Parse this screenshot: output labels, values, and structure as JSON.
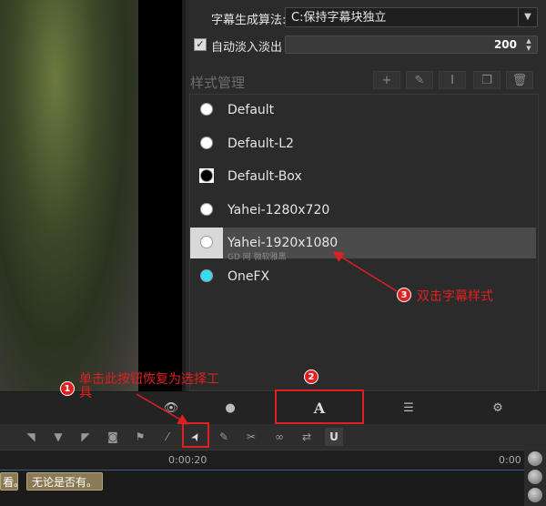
{
  "settings": {
    "algorithm_label": "字幕生成算法:",
    "algorithm_value": "C:保持字幕块独立",
    "fade_label": "自动淡入淡出",
    "fade_checked": true,
    "fade_value": "200"
  },
  "style_manager": {
    "title": "样式管理",
    "buttons": [
      {
        "icon": "plus-icon",
        "glyph": "+"
      },
      {
        "icon": "pencil-icon",
        "glyph": "✎"
      },
      {
        "icon": "text-cursor-icon",
        "glyph": "I"
      },
      {
        "icon": "copy-icon",
        "glyph": "❐"
      },
      {
        "icon": "trash-icon",
        "glyph": "🗑"
      }
    ],
    "items": [
      {
        "label": "Default",
        "dot_color": "#ffffff"
      },
      {
        "label": "Default-L2",
        "dot_color": "#ffffff"
      },
      {
        "label": "Default-Box",
        "dot_color": "#000000"
      },
      {
        "label": "Yahei-1280x720",
        "dot_color": "#ffffff"
      },
      {
        "label": "Yahei-1920x1080",
        "dot_color": "#ffffff",
        "selected": true
      },
      {
        "label": "OneFX",
        "dot_color": "#33ddf5"
      }
    ],
    "watermark": "GD 网 微软雅黑"
  },
  "tabs": [
    {
      "name": "eye-icon",
      "glyph": "👁"
    },
    {
      "name": "chat-bubble-icon",
      "glyph": "●"
    },
    {
      "name": "text-style-icon",
      "glyph": "A"
    },
    {
      "name": "list-icon",
      "glyph": "☰"
    },
    {
      "name": "gear-icon",
      "glyph": "⚙"
    }
  ],
  "toolbar": [
    {
      "name": "marker-in-icon",
      "glyph": "◥"
    },
    {
      "name": "marker-down-icon",
      "glyph": "▼"
    },
    {
      "name": "marker-out-icon",
      "glyph": "◤"
    },
    {
      "name": "camera-icon",
      "glyph": "◙"
    },
    {
      "name": "bookmark-icon",
      "glyph": "⚑"
    },
    {
      "name": "magic-wand-icon",
      "glyph": "⁄"
    },
    {
      "name": "pointer-icon",
      "glyph": "➤"
    },
    {
      "name": "edit-icon",
      "glyph": "✎"
    },
    {
      "name": "scissors-icon",
      "glyph": "✂"
    },
    {
      "name": "link-icon",
      "glyph": "∞"
    },
    {
      "name": "swap-icon",
      "glyph": "⇄"
    },
    {
      "name": "magnet-icon",
      "glyph": "U"
    }
  ],
  "timeline": {
    "ticks": [
      "0:00:20",
      "0:00"
    ],
    "clips": [
      "看。",
      "无论是否有。"
    ]
  },
  "annotations": {
    "step1_number": "1",
    "step1_text": "单击此按钮恢复为选择工具",
    "step2_number": "2",
    "step3_number": "3",
    "step3_text": "双击字幕样式",
    "color": "#e02020"
  }
}
